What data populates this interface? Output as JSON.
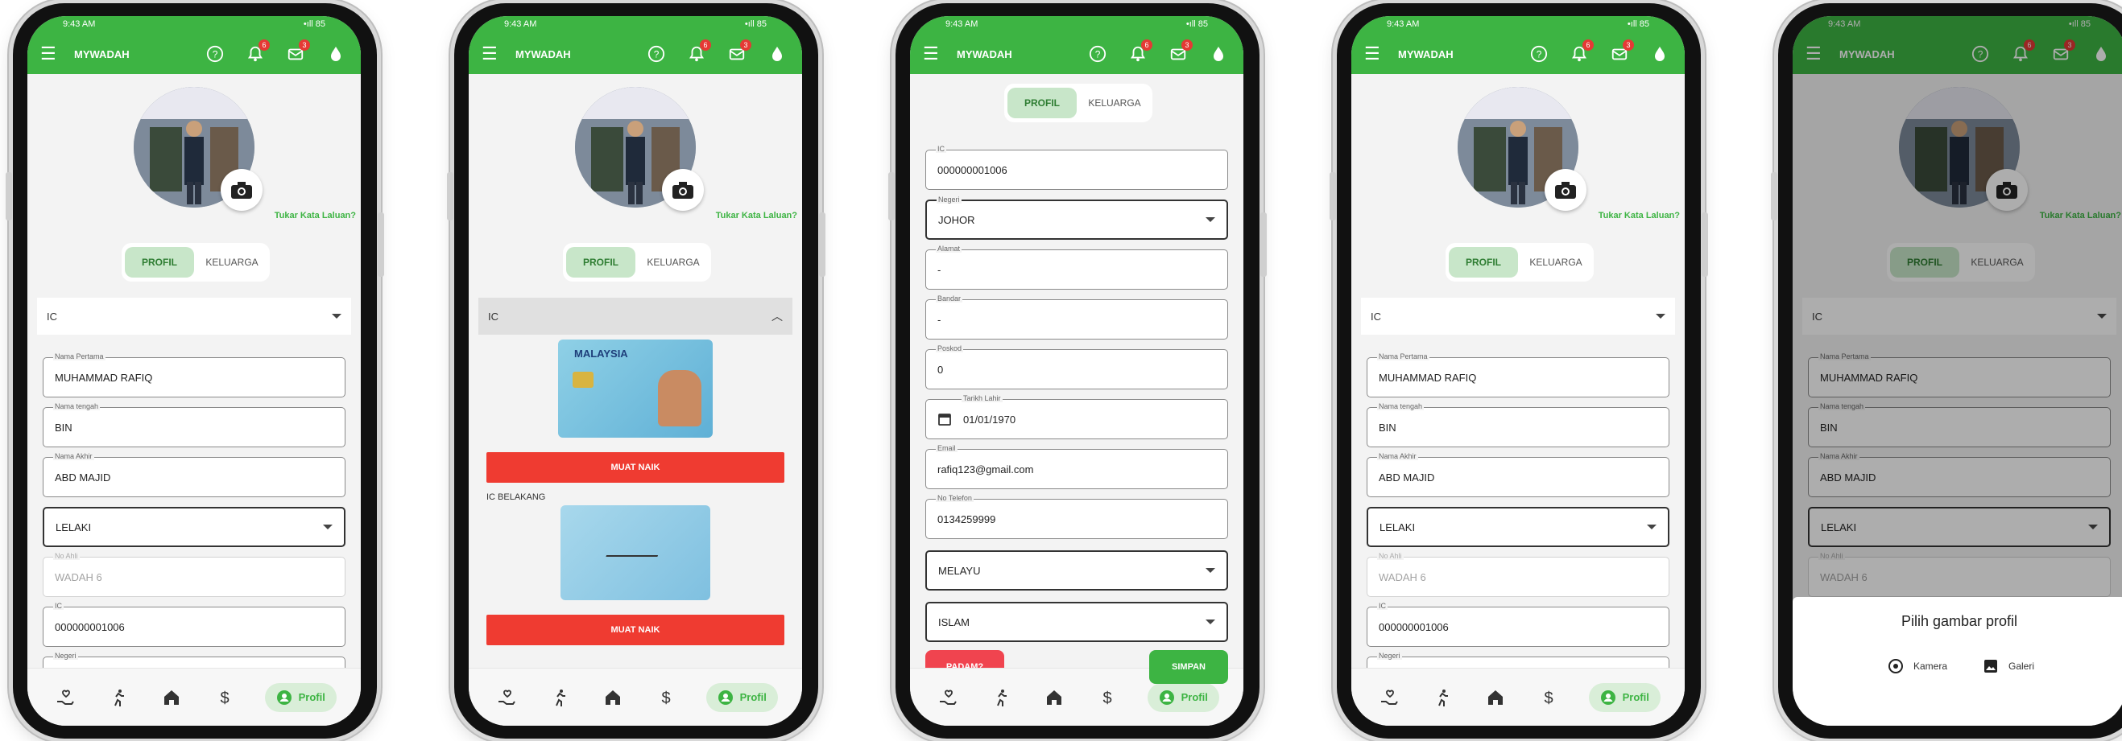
{
  "app": {
    "title": "MYWADAH",
    "status_time": "9:43 AM",
    "status_right": "•ıll 85",
    "notif_count": "6",
    "mail_count": "3",
    "colors": {
      "primary": "#3db443",
      "danger": "#ef3b31",
      "tab_active_bg": "#c8e6c9"
    }
  },
  "profile": {
    "change_password": "Tukar Kata Laluan?",
    "tabs": [
      "PROFIL",
      "KELUARGA"
    ],
    "ic_section": "IC",
    "fields": [
      {
        "label": "Nama Pertama",
        "value": "MUHAMMAD RAFIQ"
      },
      {
        "label": "Nama tengah",
        "value": "BIN"
      },
      {
        "label": "Nama Akhir",
        "value": "ABD MAJID"
      },
      {
        "label": "",
        "value": "LELAKI"
      },
      {
        "label": "No Ahli",
        "value": "WADAH 6"
      },
      {
        "label": "IC",
        "value": "000000001006"
      },
      {
        "label": "Negeri",
        "value": ""
      }
    ]
  },
  "ic_upload": {
    "upload_label": "MUAT NAIK",
    "back_label": "IC BELAKANG",
    "card_text": "MALAYSIA"
  },
  "profile_form": {
    "fields": [
      {
        "label": "IC",
        "value": "000000001006"
      },
      {
        "label": "Negeri",
        "value": "JOHOR"
      },
      {
        "label": "Alamat",
        "value": "-"
      },
      {
        "label": "Bandar",
        "value": "-"
      },
      {
        "label": "Poskod",
        "value": "0"
      },
      {
        "label": "Tarikh Lahir",
        "value": "01/01/1970"
      },
      {
        "label": "Email",
        "value": "rafiq123@gmail.com"
      },
      {
        "label": "No Telefon",
        "value": "0134259999"
      },
      {
        "label": "",
        "value": "MELAYU"
      },
      {
        "label": "",
        "value": "ISLAM"
      }
    ],
    "delete_label": "PADAM?",
    "save_label": "SIMPAN"
  },
  "picker": {
    "title": "Pilih gambar profil",
    "camera": "Kamera",
    "gallery": "Galeri"
  },
  "nav": {
    "profile_label": "Profil",
    "icons": [
      "donate-icon",
      "run-icon",
      "home-icon",
      "dollar-icon",
      "profile-icon"
    ]
  }
}
